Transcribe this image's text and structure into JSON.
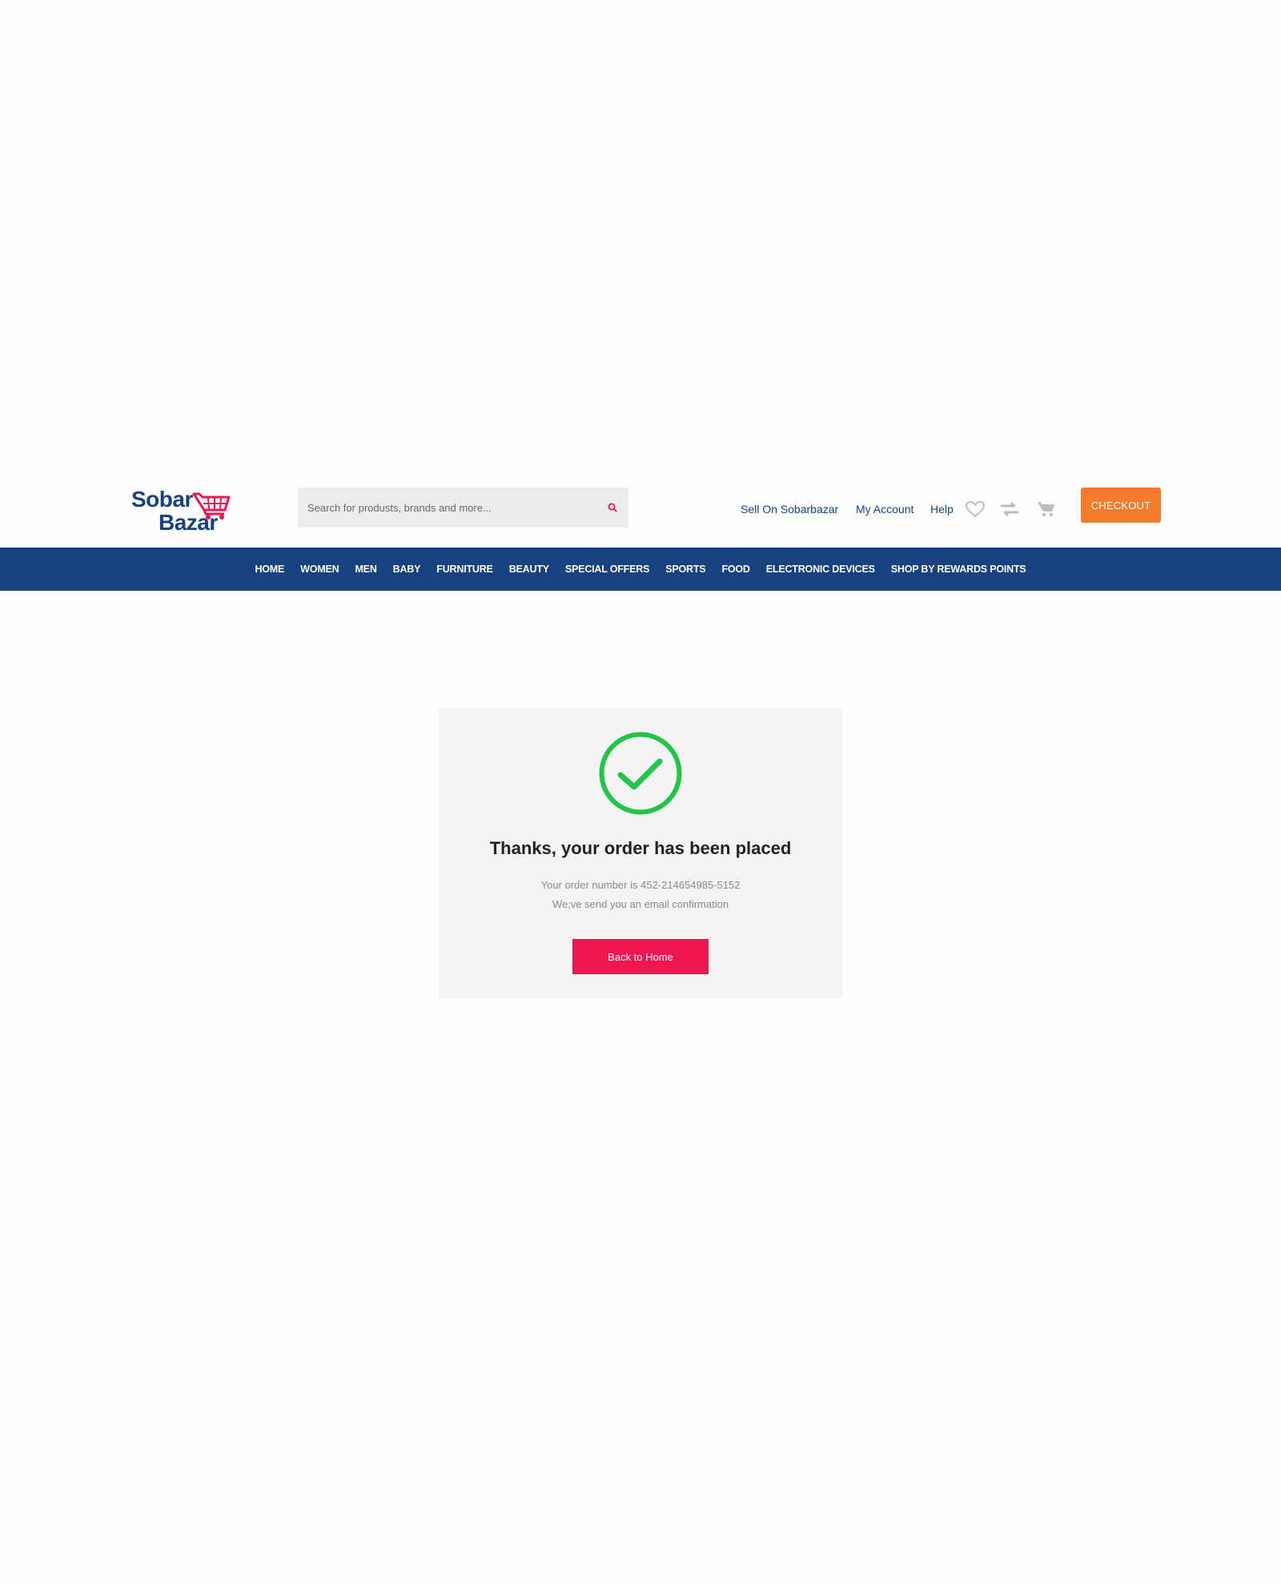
{
  "header": {
    "logo": {
      "line1": "Sobar",
      "line2": "Bazar"
    },
    "search": {
      "placeholder": "Search for produsts, brands and more..."
    },
    "links": {
      "sell": "Sell On Sobarbazar",
      "account": "My Account",
      "help": "Help"
    },
    "icons": [
      "heart-icon",
      "compare-icon",
      "cart-icon"
    ],
    "checkout_label": "CHECKOUT"
  },
  "nav": {
    "items": [
      {
        "label": "HOME"
      },
      {
        "label": "WOMEN"
      },
      {
        "label": "MEN"
      },
      {
        "label": "BABY"
      },
      {
        "label": "FURNITURE"
      },
      {
        "label": "BEAUTY"
      },
      {
        "label": "SPECIAL OFFERS"
      },
      {
        "label": "SPORTS"
      },
      {
        "label": "FOOD"
      },
      {
        "label": "ELECTRONIC DEVICES"
      },
      {
        "label": "SHOP BY REWARDS POINTS"
      }
    ]
  },
  "confirmation": {
    "icon": "check-circle-icon",
    "title": "Thanks, your order has been placed",
    "order_text": "Your order number is 452-214654985-5152",
    "email_text": "We;ve send you an email confirmation",
    "button_label": "Back to Home"
  },
  "colors": {
    "brand_blue": "#17417f",
    "brand_pink": "#ef1652",
    "checkout_orange": "#f47c2c",
    "success_green": "#22c44a"
  }
}
